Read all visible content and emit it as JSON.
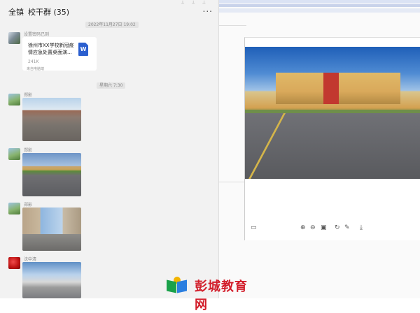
{
  "header": {
    "back_label": "全镇",
    "title": "校干群 (35)",
    "more_label": "..."
  },
  "messages": [
    {
      "type": "timestamp",
      "text": "2022年11月27日 19:02"
    },
    {
      "type": "file",
      "sender": "设置密码已到",
      "file_name": "徐州市XX学校新冠疫情应急处置桌面演...",
      "file_size": "241K",
      "file_icon": "W",
      "source": "来自电脑端"
    },
    {
      "type": "timestamp",
      "text": "星期六 7:30"
    },
    {
      "type": "image",
      "sender": "郑影"
    },
    {
      "type": "image",
      "sender": "郑影"
    },
    {
      "type": "image",
      "sender": "郑影"
    },
    {
      "type": "image",
      "sender": "沈中清"
    }
  ],
  "viewer": {
    "toolbar_icons": [
      "fit-screen-icon",
      "zoom-in-icon",
      "zoom-out-icon",
      "original-size-icon",
      "rotate-icon",
      "edit-icon",
      "download-icon"
    ]
  },
  "watermark": {
    "text": "彭城教育网"
  },
  "colors": {
    "chat_bg": "#f2f2f2",
    "file_icon_blue": "#2b5fcf",
    "watermark_red": "#d21d2a"
  }
}
